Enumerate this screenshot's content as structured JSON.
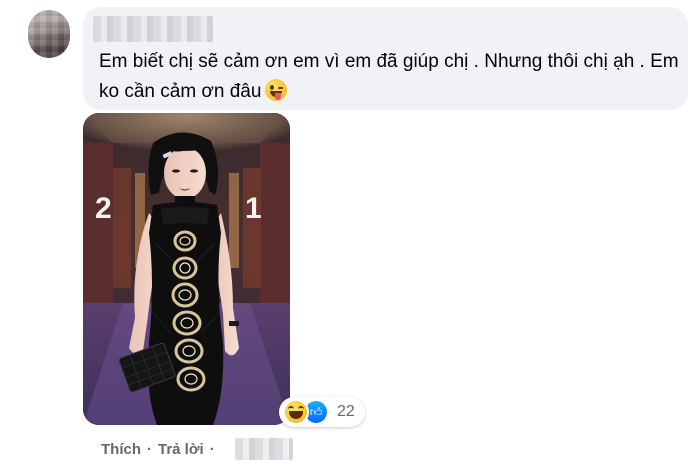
{
  "comment": {
    "author_name": "",
    "text": "Em biết chị sẽ cảm ơn em vì em đã giúp chị . Nhưng thôi chị ạh . Em ko cần cảm ơn đâu",
    "emoji_icon": "winking-tongue-emoji"
  },
  "photo": {
    "background_number_left": "2",
    "background_number_right": "1",
    "dress_logo_count": 6
  },
  "reactions": {
    "icons": [
      "haha-reaction-icon",
      "like-reaction-icon"
    ],
    "count": "22"
  },
  "actions": {
    "like_label": "Thích",
    "separator": "·",
    "reply_label": "Trả lời",
    "separator2": "·",
    "timestamp": ""
  },
  "colors": {
    "bubble": "#f0f2f5",
    "action_text": "#65676b",
    "like_blue": "#0866ff"
  }
}
